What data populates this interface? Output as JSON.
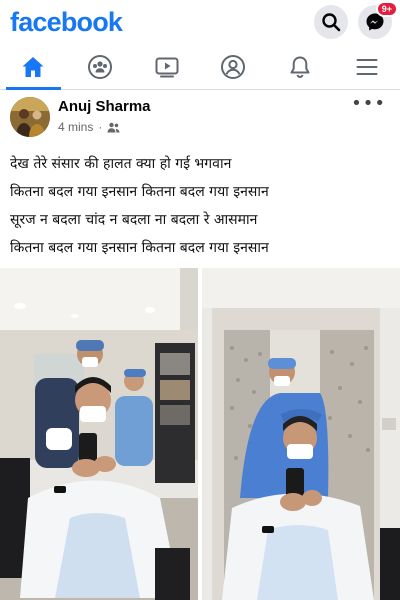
{
  "app": {
    "logo_text": "facebook"
  },
  "top_actions": [
    {
      "icon": "search-icon"
    },
    {
      "icon": "messenger-icon",
      "badge": "9+"
    }
  ],
  "nav_tabs": [
    {
      "icon": "home-icon",
      "active": true
    },
    {
      "icon": "groups-icon",
      "active": false
    },
    {
      "icon": "watch-icon",
      "active": false
    },
    {
      "icon": "profile-icon",
      "active": false
    },
    {
      "icon": "notifications-icon",
      "active": false
    },
    {
      "icon": "menu-icon",
      "active": false
    }
  ],
  "post": {
    "author": "Anuj Sharma",
    "time": "4 mins",
    "audience_icon": "friends-icon",
    "more_icon": "more-options-icon",
    "text_lines": [
      "देख तेरे संसार की हालत क्या हो गई भगवान",
      "कितना बदल गया इनसान कितना बदल गया इनसान",
      "सूरज न बदला चांद न बदला ना बदला रे आसमान",
      "कितना बदल गया इनसान कितना बदल गया इनसान"
    ]
  },
  "colors": {
    "brand": "#1877f2",
    "badge": "#e41e3f",
    "icon_gray": "#606770",
    "tab_underline": "#1877f2"
  }
}
